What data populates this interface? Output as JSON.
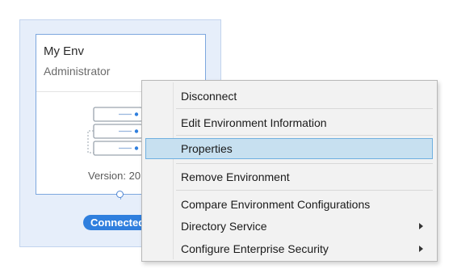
{
  "environment": {
    "name": "My Env",
    "role": "Administrator",
    "version": "Version: 20",
    "status": "Connected",
    "accent_color": "#2f7fde"
  },
  "context_menu": {
    "items": [
      {
        "label": "Disconnect"
      },
      {
        "label": "Edit Environment Information"
      },
      {
        "label": "Properties",
        "highlighted": true
      },
      {
        "label": "Remove Environment"
      },
      {
        "label": "Compare Environment Configurations"
      },
      {
        "label": "Directory Service",
        "submenu": true
      },
      {
        "label": "Configure Enterprise Security",
        "submenu": true
      }
    ]
  }
}
